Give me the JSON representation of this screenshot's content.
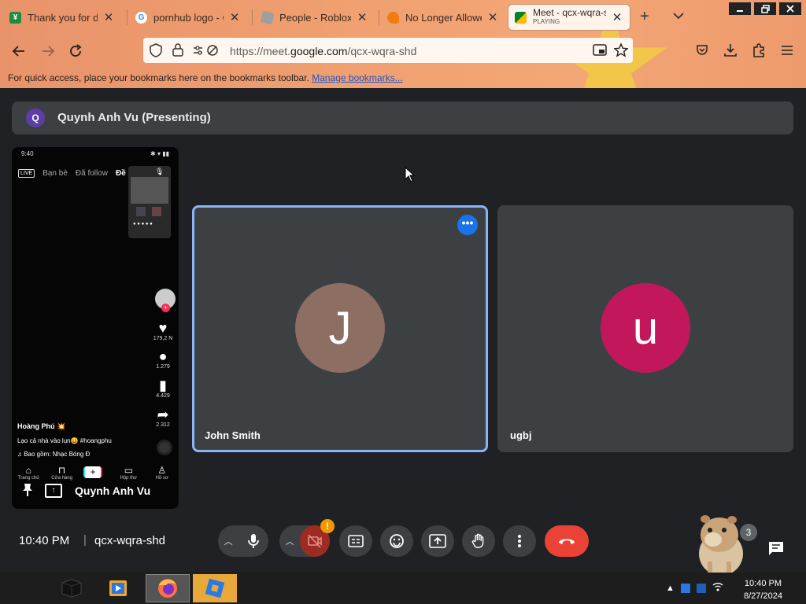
{
  "browser": {
    "tabs": [
      {
        "title": "Thank you for do",
        "favicon_color": "#1e8e3e",
        "favicon_letter": "¥"
      },
      {
        "title": "pornhub logo - Go",
        "favicon_color": "#ffffff",
        "favicon_letter": "G"
      },
      {
        "title": "People - Roblox",
        "favicon_color": "#9e9e9e",
        "favicon_letter": ""
      },
      {
        "title": "No Longer Allowe",
        "favicon_color": "#f07d12",
        "favicon_letter": ""
      },
      {
        "title": "Meet - qcx-wqra-sh",
        "subtitle": "PLAYING",
        "favicon_color": "#00832d",
        "favicon_letter": ""
      }
    ],
    "new_tab_label": "+",
    "url_prefix": "https://meet.",
    "url_domain": "google.com",
    "url_path": "/qcx-wqra-shd",
    "bookmarks_text": "For quick access, place your bookmarks here on the bookmarks toolbar.",
    "bookmarks_link": "Manage bookmarks..."
  },
  "meet": {
    "presenting_initial": "Q",
    "presenting_label": "Quynh Anh Vu (Presenting)",
    "presenter_name": "Quynh Anh Vu",
    "participants": [
      {
        "name": "John Smith",
        "initial": "J",
        "color": "#8d6e63",
        "speaking": true
      },
      {
        "name": "ugbj",
        "initial": "u",
        "color": "#c2185b",
        "speaking": false
      }
    ],
    "time": "10:40 PM",
    "separator": "|",
    "meeting_code": "qcx-wqra-shd",
    "camera_warning": "!",
    "people_count": "3"
  },
  "phone": {
    "status_time": "9:40",
    "tab_live": "LIVE",
    "tab_friends": "Bạn bè",
    "tab_following": "Đã follow",
    "tab_foryou": "Đề",
    "likes": "179,2 N",
    "comments": "1.279",
    "saves": "4.429",
    "shares": "2.312",
    "author": "Hoàng Phú 💥",
    "caption": "Lạo cả nhà vào lụn😄 #hoangphu",
    "music": "♫ Bao gồm: Nhạc Bóng Đ",
    "nav_home": "Trang chủ",
    "nav_shop": "Cửa hàng",
    "nav_inbox": "Hộp thư",
    "nav_profile": "Hồ sơ"
  },
  "taskbar": {
    "clock_time": "10:40 PM",
    "clock_date": "8/27/2024"
  }
}
